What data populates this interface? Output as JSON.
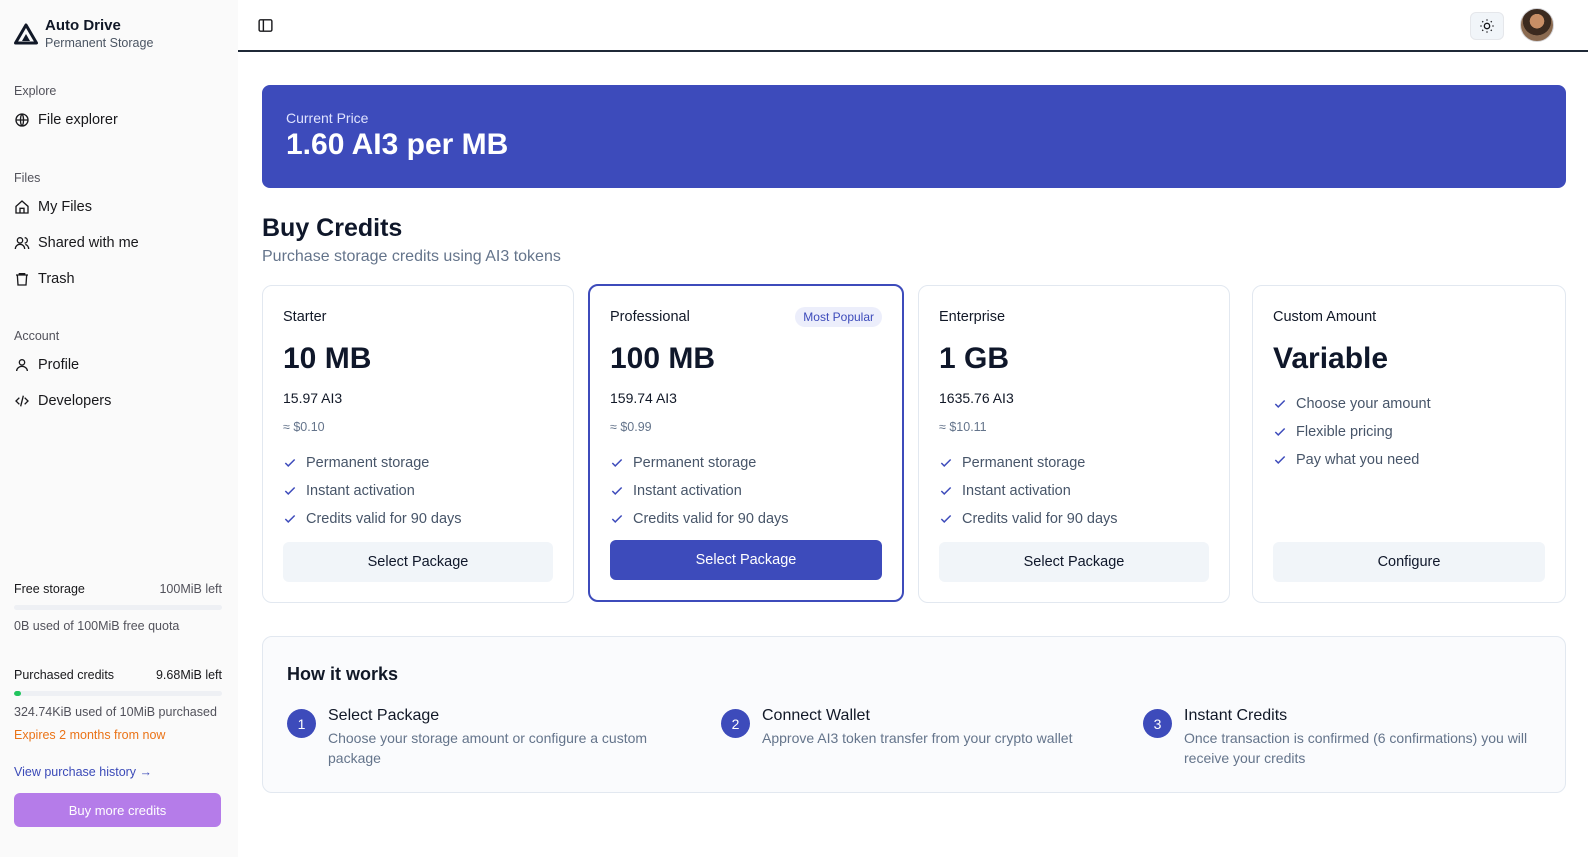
{
  "app": {
    "title": "Auto Drive",
    "subtitle": "Permanent Storage"
  },
  "sidebar": {
    "explore": {
      "heading": "Explore",
      "items": [
        {
          "label": "File explorer",
          "icon": "globe-icon"
        }
      ]
    },
    "files": {
      "heading": "Files",
      "items": [
        {
          "label": "My Files",
          "icon": "home-icon"
        },
        {
          "label": "Shared with me",
          "icon": "users-icon"
        },
        {
          "label": "Trash",
          "icon": "trash-icon"
        }
      ]
    },
    "account": {
      "heading": "Account",
      "items": [
        {
          "label": "Profile",
          "icon": "user-icon"
        },
        {
          "label": "Developers",
          "icon": "code-icon"
        }
      ]
    },
    "free_storage": {
      "label": "Free storage",
      "left": "100MiB left",
      "used_note": "0B used of 100MiB free quota",
      "fraction_used": 0
    },
    "purchased": {
      "label": "Purchased credits",
      "left": "9.68MiB left",
      "used_note": "324.74KiB used of 10MiB purchased",
      "expires": "Expires 2 months from now",
      "fraction_used": 0.032
    },
    "history_link": "View purchase history →",
    "buy_more": "Buy more credits"
  },
  "header": {
    "sidebar_toggle_icon": "panel-left-icon",
    "theme_icon": "sun-icon"
  },
  "price": {
    "label": "Current Price",
    "value": "1.60 AI3 per MB"
  },
  "buy": {
    "title": "Buy Credits",
    "subtitle": "Purchase storage credits using AI3 tokens"
  },
  "packages": [
    {
      "name": "Starter",
      "size": "10 MB",
      "ai3": "15.97 AI3",
      "usd": "≈ $0.10",
      "features": [
        "Permanent storage",
        "Instant activation",
        "Credits valid for 90 days"
      ],
      "button": "Select Package"
    },
    {
      "name": "Professional",
      "badge": "Most Popular",
      "size": "100 MB",
      "ai3": "159.74 AI3",
      "usd": "≈ $0.99",
      "features": [
        "Permanent storage",
        "Instant activation",
        "Credits valid for 90 days"
      ],
      "button": "Select Package"
    },
    {
      "name": "Enterprise",
      "size": "1 GB",
      "ai3": "1635.76 AI3",
      "usd": "≈ $10.11",
      "features": [
        "Permanent storage",
        "Instant activation",
        "Credits valid for 90 days"
      ],
      "button": "Select Package"
    },
    {
      "name": "Custom Amount",
      "size": "Variable",
      "features": [
        "Choose your amount",
        "Flexible pricing",
        "Pay what you need"
      ],
      "button": "Configure"
    }
  ],
  "how": {
    "title": "How it works",
    "steps": [
      {
        "num": "1",
        "title": "Select Package",
        "desc": "Choose your storage amount or configure a custom package"
      },
      {
        "num": "2",
        "title": "Connect Wallet",
        "desc": "Approve AI3 token transfer from your crypto wallet"
      },
      {
        "num": "3",
        "title": "Instant Credits",
        "desc": "Once transaction is confirmed (6 confirmations) you will receive your credits"
      }
    ]
  },
  "colors": {
    "accent": "#3d4bbb",
    "buy_more": "#b57ce9",
    "expires": "#ea7317",
    "progress": "#22c55e"
  }
}
